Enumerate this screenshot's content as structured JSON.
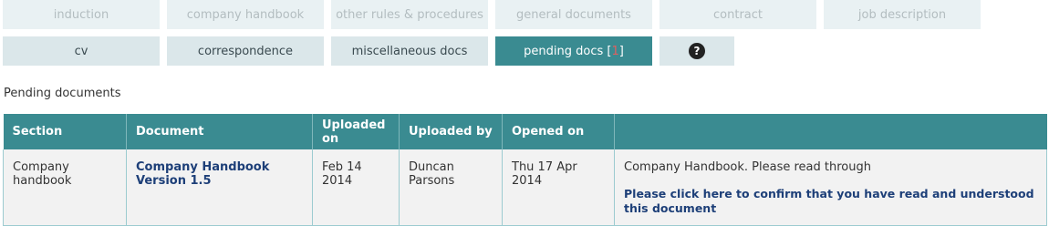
{
  "tabs_row1": [
    {
      "label": "induction"
    },
    {
      "label": "company handbook"
    },
    {
      "label": "other rules & procedures"
    },
    {
      "label": "general documents"
    },
    {
      "label": "contract"
    },
    {
      "label": "job description"
    }
  ],
  "tabs_row2": [
    {
      "label": "cv"
    },
    {
      "label": "correspondence"
    },
    {
      "label": "miscellaneous docs"
    },
    {
      "label": "pending docs",
      "count_open": "[",
      "count": "1",
      "count_close": "]"
    }
  ],
  "help": {
    "icon": "question-circle-icon",
    "glyph": "?"
  },
  "section_title": "Pending documents",
  "table": {
    "headers": [
      "Section",
      "Document",
      "Uploaded on",
      "Uploaded by",
      "Opened on",
      ""
    ],
    "rows": [
      {
        "section": "Company handbook",
        "document": "Company Handbook Version 1.5",
        "uploaded_on": "Feb 14 2014",
        "uploaded_by": "Duncan Parsons",
        "opened_on": "Thu 17 Apr 2014",
        "note": "Company Handbook. Please read through",
        "confirm_link": "Please click here to confirm that you have read and understood this document"
      }
    ]
  },
  "colors": {
    "accent": "#3a8b91",
    "tab_bg": "#dbe7ea",
    "link": "#1d3f78"
  }
}
